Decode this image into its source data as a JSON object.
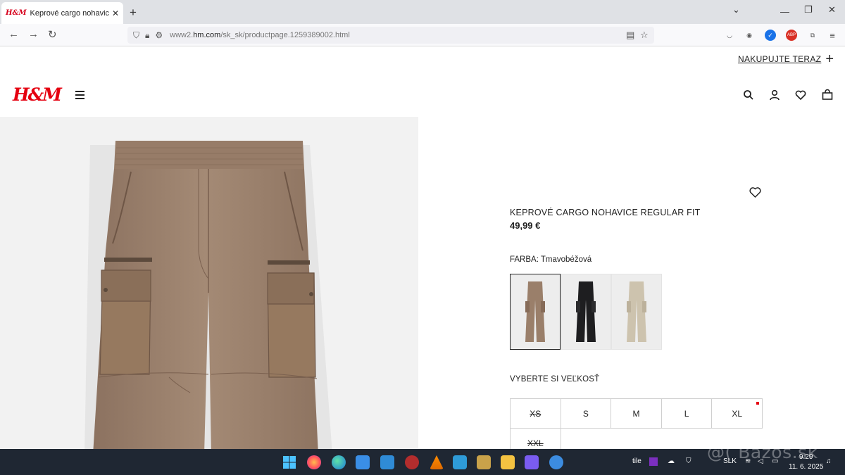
{
  "browser": {
    "tab_title": "Keprové cargo nohavice Regular Fit | H&M",
    "tab_favicon": "H&M",
    "url_prefix": "www2.",
    "url_domain": "hm.com",
    "url_path": "/sk_sk/productpage.1259389002.html"
  },
  "header": {
    "shop_now_label": "NAKUPUJTE TERAZ",
    "logo_text": "H&M",
    "icons": [
      "search-icon",
      "account-icon",
      "favorites-icon",
      "shopping-bag-icon"
    ]
  },
  "product": {
    "name": "KEPROVÉ CARGO NOHAVICE REGULAR FIT",
    "price": "49,99 €",
    "color_label": "FARBA: Tmavobéžová",
    "colors": [
      {
        "hex": "#9a7f6a",
        "selected": true
      },
      {
        "hex": "#1e1e20",
        "selected": false
      },
      {
        "hex": "#cdc3ae",
        "selected": false
      }
    ],
    "size_label": "VYBERTE SI VEĽKOSŤ",
    "sizes": [
      {
        "label": "XS",
        "available": false
      },
      {
        "label": "S",
        "available": true
      },
      {
        "label": "M",
        "available": true
      },
      {
        "label": "L",
        "available": true
      },
      {
        "label": "XL",
        "available": true,
        "low_stock": true
      },
      {
        "label": "XXL",
        "available": false
      }
    ]
  },
  "taskbar": {
    "tray_text_1": "tile",
    "language": "SLK",
    "time": "9:29",
    "date": "11. 6. 2025"
  },
  "watermark": "@( Bazos.sk",
  "colors": {
    "brand_red": "#e50010",
    "pants_main": "#9a7f6a"
  }
}
